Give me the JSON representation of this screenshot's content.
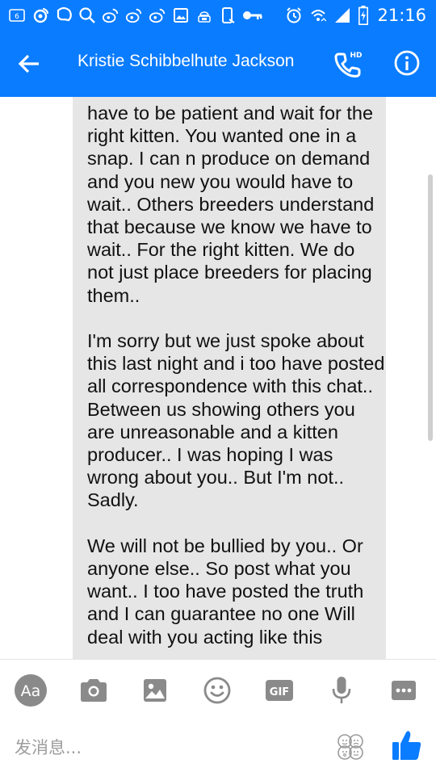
{
  "status_bar": {
    "time": "21:16",
    "notification_icons": [
      "sim-6-icon",
      "weibo-icon",
      "messenger-icon",
      "search-icon",
      "weibo-icon",
      "weibo-icon",
      "weibo-icon",
      "image-icon",
      "android-icon",
      "phone-icon",
      "key-icon"
    ],
    "system_icons": [
      "alarm-icon",
      "wifi-icon",
      "signal-icon",
      "battery-charging-icon"
    ]
  },
  "header": {
    "title": "Kristie Schibbelhute Jackson",
    "call_badge": "HD",
    "background": "#0A7CFF"
  },
  "message": {
    "paragraphs": [
      "have to be patient and wait for the right kitten. You wanted one in a snap. I can n produce on demand and you new you would have to wait..  Others breeders understand that because we know we have to wait.. For the right kitten. We do not just place breeders for placing them..",
      "I'm sorry but we just spoke about this last night and i too have posted all  correspondence with this chat.. Between us showing others you are unreasonable and a kitten producer.. I was hoping I was wrong about you.. But I'm not.. Sadly.",
      "We will not be bullied by you.. Or anyone else.. So post what you want.. I too have posted the truth and I can guarantee no one Will deal with you acting like this"
    ],
    "bubble_color": "#E6E6E6"
  },
  "composer": {
    "placeholder": "发消息...",
    "tools": {
      "text_style_label": "Aa",
      "gif_label": "GIF"
    },
    "icon_color": "#8a8a8a",
    "like_color": "#0A7CFF"
  }
}
